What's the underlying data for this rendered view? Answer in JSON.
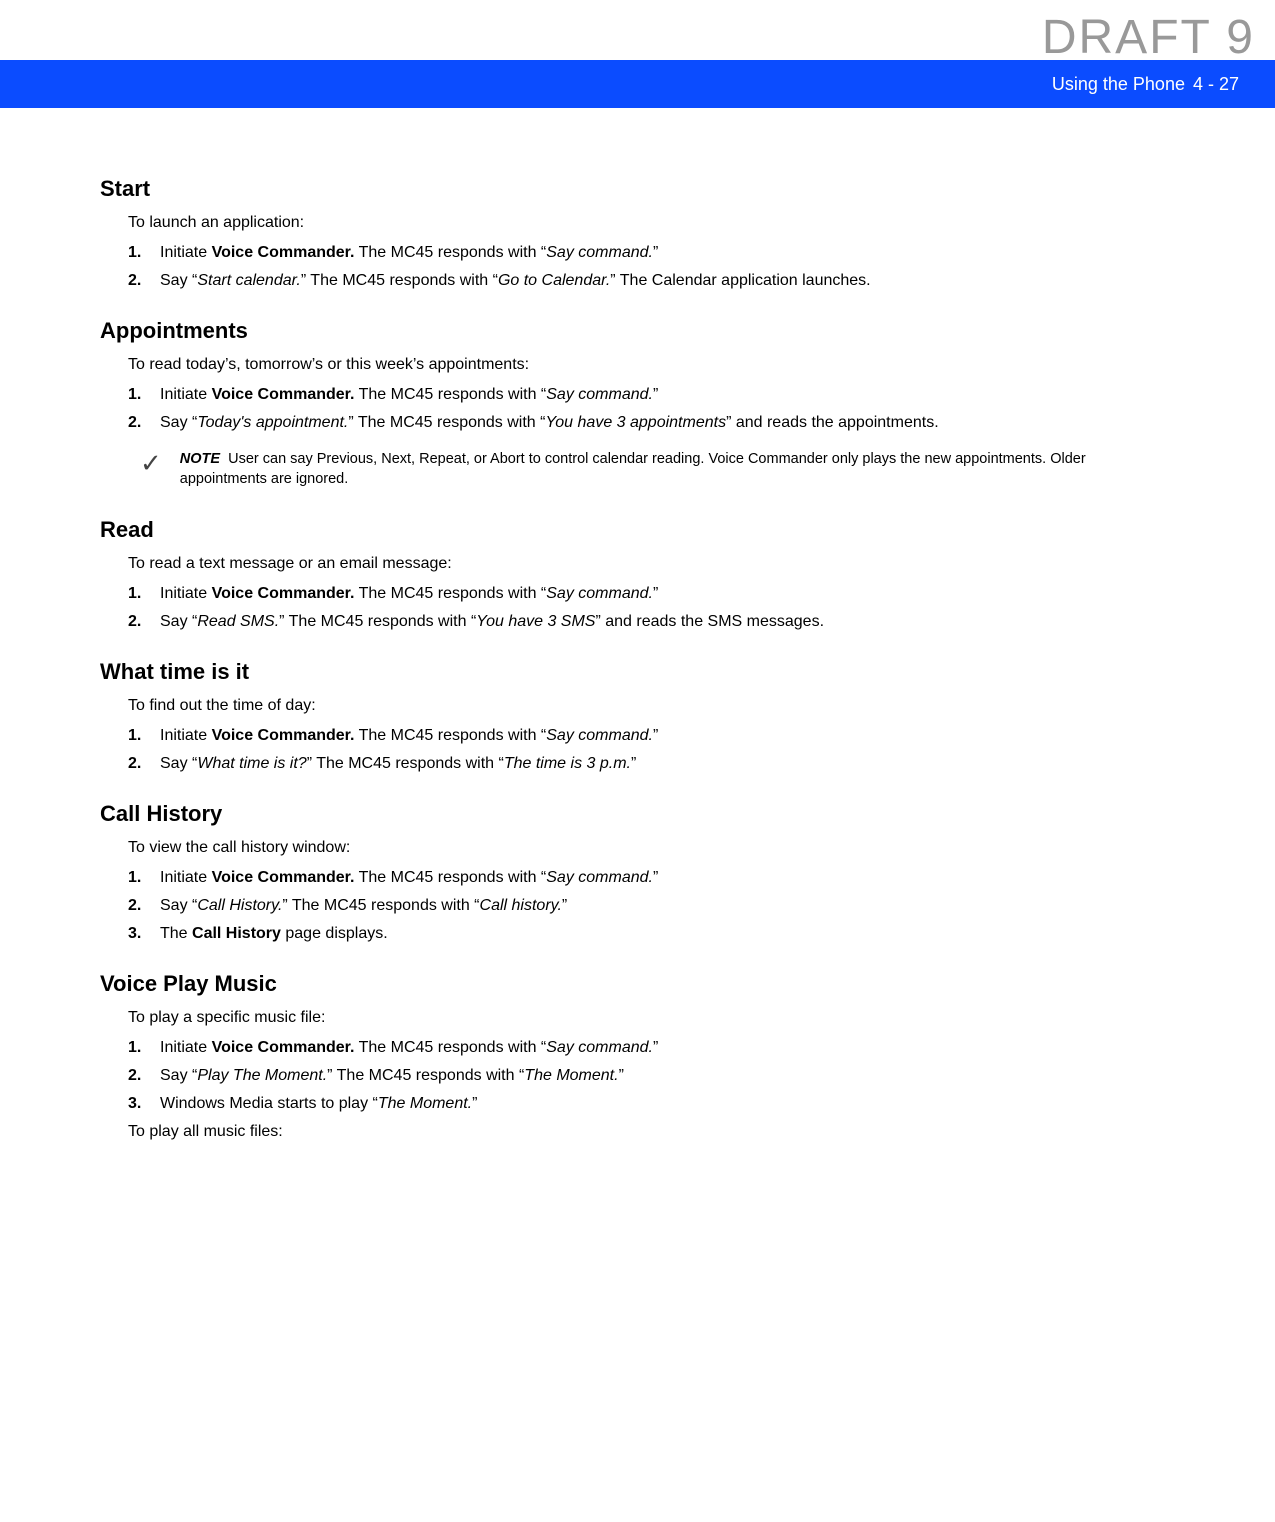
{
  "watermark": "DRAFT 9",
  "header": {
    "title": "Using the Phone",
    "page": "4 - 27"
  },
  "sections": [
    {
      "heading": "Start",
      "intro": "To launch an application:",
      "steps": [
        {
          "num": "1.",
          "runs": [
            {
              "t": "Initiate "
            },
            {
              "t": "Voice Commander.",
              "b": true
            },
            {
              "t": " The MC45 responds with “"
            },
            {
              "t": "Say command.",
              "i": true
            },
            {
              "t": "”"
            }
          ]
        },
        {
          "num": "2.",
          "runs": [
            {
              "t": "Say “"
            },
            {
              "t": "Start calendar.",
              "i": true
            },
            {
              "t": "” The MC45 responds with “"
            },
            {
              "t": "Go to Calendar.",
              "i": true
            },
            {
              "t": "” The Calendar application launches."
            }
          ]
        }
      ]
    },
    {
      "heading": "Appointments",
      "intro": "To read today’s, tomorrow’s or this week’s appointments:",
      "steps": [
        {
          "num": "1.",
          "runs": [
            {
              "t": "Initiate "
            },
            {
              "t": "Voice Commander.",
              "b": true
            },
            {
              "t": " The MC45 responds with “"
            },
            {
              "t": "Say command.",
              "i": true
            },
            {
              "t": "”"
            }
          ]
        },
        {
          "num": "2.",
          "runs": [
            {
              "t": "Say “"
            },
            {
              "t": "Today's appointment.",
              "i": true
            },
            {
              "t": "” The MC45 responds with “"
            },
            {
              "t": "You have 3 appointments",
              "i": true
            },
            {
              "t": "” and reads the appointments."
            }
          ]
        }
      ],
      "note": {
        "label": "NOTE",
        "text": "User can say Previous, Next, Repeat, or Abort to control calendar reading. Voice Commander only plays the new appointments. Older appointments are ignored."
      }
    },
    {
      "heading": "Read",
      "intro": "To read a text message or an email message:",
      "steps": [
        {
          "num": "1.",
          "runs": [
            {
              "t": "Initiate "
            },
            {
              "t": "Voice Commander.",
              "b": true
            },
            {
              "t": " The MC45 responds with “"
            },
            {
              "t": "Say command.",
              "i": true
            },
            {
              "t": "”"
            }
          ]
        },
        {
          "num": "2.",
          "runs": [
            {
              "t": "Say “"
            },
            {
              "t": "Read SMS.",
              "i": true
            },
            {
              "t": "” The MC45 responds with “"
            },
            {
              "t": "You have 3 SMS",
              "i": true
            },
            {
              "t": "” and reads the SMS messages."
            }
          ]
        }
      ]
    },
    {
      "heading": "What time is it",
      "intro": "To find out the time of day:",
      "steps": [
        {
          "num": "1.",
          "runs": [
            {
              "t": "Initiate "
            },
            {
              "t": "Voice Commander.",
              "b": true
            },
            {
              "t": " The MC45 responds with “"
            },
            {
              "t": "Say command.",
              "i": true
            },
            {
              "t": "”"
            }
          ]
        },
        {
          "num": "2.",
          "runs": [
            {
              "t": "Say “"
            },
            {
              "t": "What time is it?",
              "i": true
            },
            {
              "t": "” The MC45 responds with “"
            },
            {
              "t": "The time is 3 p.m.",
              "i": true
            },
            {
              "t": "”"
            }
          ]
        }
      ]
    },
    {
      "heading": "Call History",
      "intro": "To view the call history window:",
      "steps": [
        {
          "num": "1.",
          "runs": [
            {
              "t": "Initiate "
            },
            {
              "t": "Voice Commander.",
              "b": true
            },
            {
              "t": " The MC45 responds with “"
            },
            {
              "t": "Say command.",
              "i": true
            },
            {
              "t": "”"
            }
          ]
        },
        {
          "num": "2.",
          "runs": [
            {
              "t": "Say “"
            },
            {
              "t": "Call History.",
              "i": true
            },
            {
              "t": "” The MC45 responds with “"
            },
            {
              "t": "Call history.",
              "i": true
            },
            {
              "t": "”"
            }
          ]
        },
        {
          "num": "3.",
          "runs": [
            {
              "t": "The "
            },
            {
              "t": "Call History",
              "b": true
            },
            {
              "t": " page displays."
            }
          ]
        }
      ]
    },
    {
      "heading": "Voice Play Music",
      "intro": "To play a specific music file:",
      "steps": [
        {
          "num": "1.",
          "runs": [
            {
              "t": "Initiate "
            },
            {
              "t": "Voice Commander.",
              "b": true
            },
            {
              "t": " The MC45 responds with “"
            },
            {
              "t": "Say command.",
              "i": true
            },
            {
              "t": "”"
            }
          ]
        },
        {
          "num": "2.",
          "runs": [
            {
              "t": "Say “"
            },
            {
              "t": "Play The Moment.",
              "i": true
            },
            {
              "t": "” The MC45 responds with “"
            },
            {
              "t": "The Moment.",
              "i": true
            },
            {
              "t": "”"
            }
          ]
        },
        {
          "num": "3.",
          "runs": [
            {
              "t": "Windows Media starts to play “"
            },
            {
              "t": "The Moment.",
              "i": true
            },
            {
              "t": "”"
            }
          ]
        }
      ],
      "outro": "To play all music files:"
    }
  ]
}
